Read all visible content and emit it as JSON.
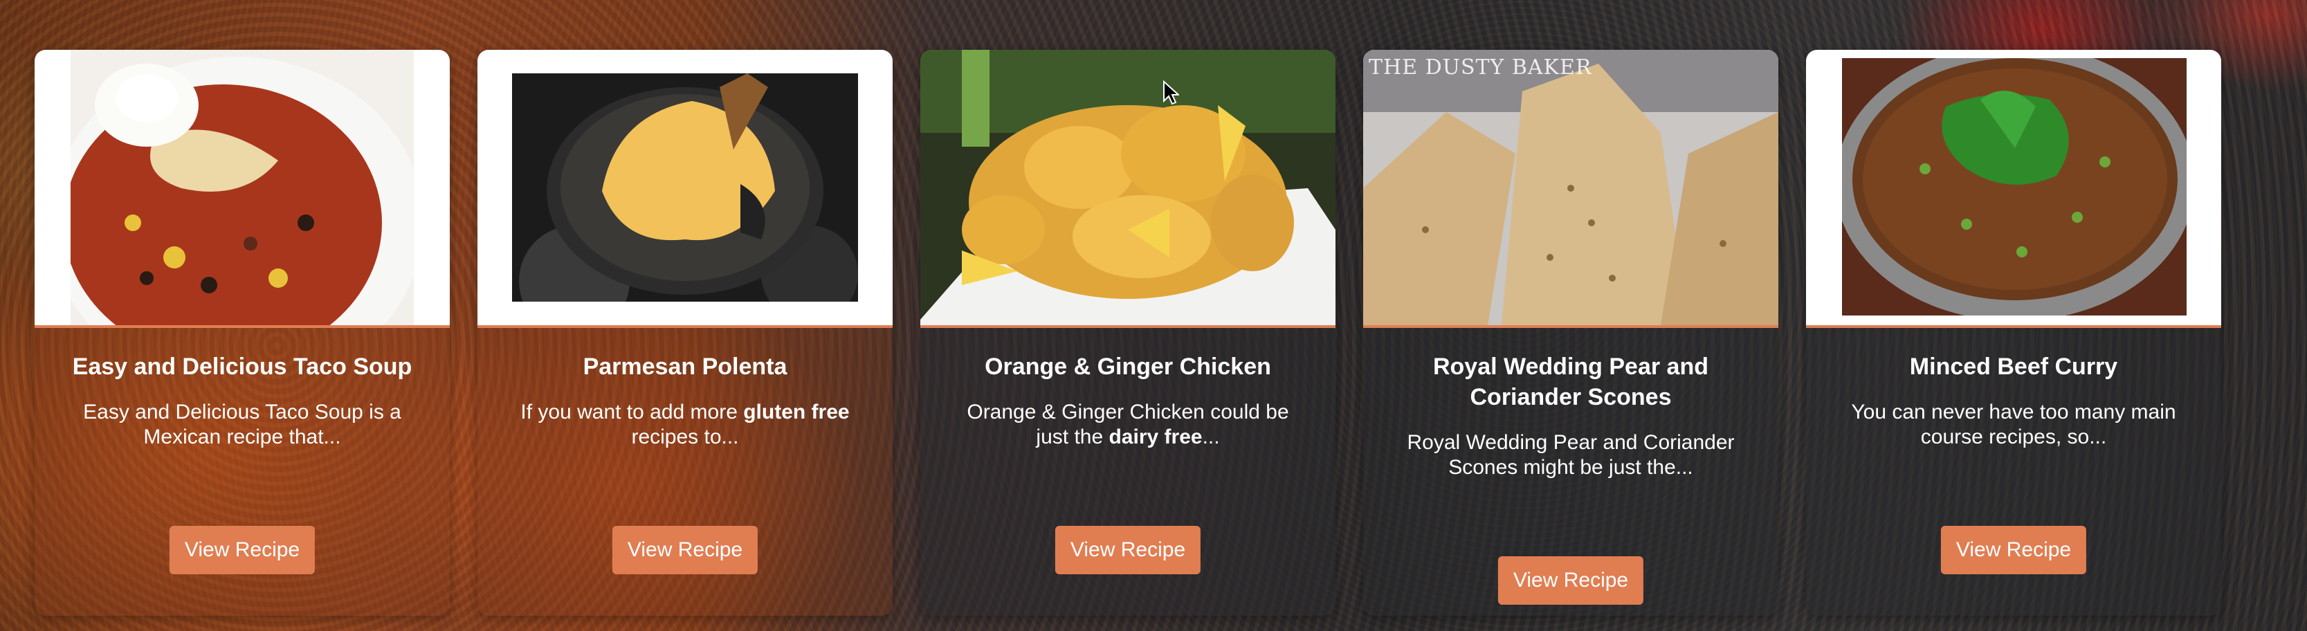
{
  "cards": [
    {
      "title": "Easy and Delicious Taco Soup",
      "description": "Easy and Delicious Taco Soup is a Mexican recipe that...",
      "button": "View Recipe"
    },
    {
      "title": "Parmesan Polenta",
      "description_pre": "If you want to add more ",
      "description_bold": "gluten free",
      "description_post": " recipes to...",
      "button": "View Recipe"
    },
    {
      "title": "Orange & Ginger Chicken",
      "description_pre": "Orange & Ginger Chicken could be just the ",
      "description_bold": "dairy free",
      "description_post": "...",
      "button": "View Recipe"
    },
    {
      "title": "Royal Wedding Pear and Coriander Scones",
      "description": "Royal Wedding Pear and Coriander Scones might be just the...",
      "button": "View Recipe",
      "watermark": "THE DUSTY BAKER"
    },
    {
      "title": "Minced Beef Curry",
      "description": "You can never have too many main course recipes, so...",
      "button": "View Recipe"
    }
  ],
  "colors": {
    "accent": "#e07e52",
    "card_text": "#ffffff"
  },
  "icons": [
    "mouse-cursor-icon"
  ]
}
